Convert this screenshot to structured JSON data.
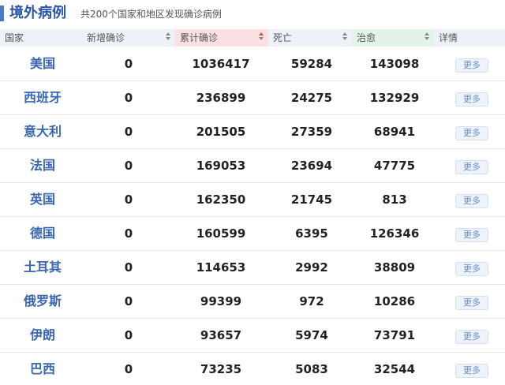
{
  "header": {
    "title": "境外病例",
    "subtitle": "共200个国家和地区发现确诊病例"
  },
  "columns": {
    "country": "国家",
    "new": "新增确诊",
    "total": "累计确诊",
    "death": "死亡",
    "cure": "治愈",
    "detail": "详情"
  },
  "colors": {
    "accent": "#2b58a8",
    "total_header_bg": "#fbe1e1",
    "cure_header_bg": "#e3f3ea",
    "default_header_bg": "#eef2f8",
    "sort_active": "#e04848"
  },
  "rows": [
    {
      "country": "美国",
      "new": "0",
      "total": "1036417",
      "death": "59284",
      "cure": "143098",
      "detail": "更多"
    },
    {
      "country": "西班牙",
      "new": "0",
      "total": "236899",
      "death": "24275",
      "cure": "132929",
      "detail": "更多"
    },
    {
      "country": "意大利",
      "new": "0",
      "total": "201505",
      "death": "27359",
      "cure": "68941",
      "detail": "更多"
    },
    {
      "country": "法国",
      "new": "0",
      "total": "169053",
      "death": "23694",
      "cure": "47775",
      "detail": "更多"
    },
    {
      "country": "英国",
      "new": "0",
      "total": "162350",
      "death": "21745",
      "cure": "813",
      "detail": "更多"
    },
    {
      "country": "德国",
      "new": "0",
      "total": "160599",
      "death": "6395",
      "cure": "126346",
      "detail": "更多"
    },
    {
      "country": "土耳其",
      "new": "0",
      "total": "114653",
      "death": "2992",
      "cure": "38809",
      "detail": "更多"
    },
    {
      "country": "俄罗斯",
      "new": "0",
      "total": "99399",
      "death": "972",
      "cure": "10286",
      "detail": "更多"
    },
    {
      "country": "伊朗",
      "new": "0",
      "total": "93657",
      "death": "5974",
      "cure": "73791",
      "detail": "更多"
    },
    {
      "country": "巴西",
      "new": "0",
      "total": "73235",
      "death": "5083",
      "cure": "32544",
      "detail": "更多"
    }
  ]
}
